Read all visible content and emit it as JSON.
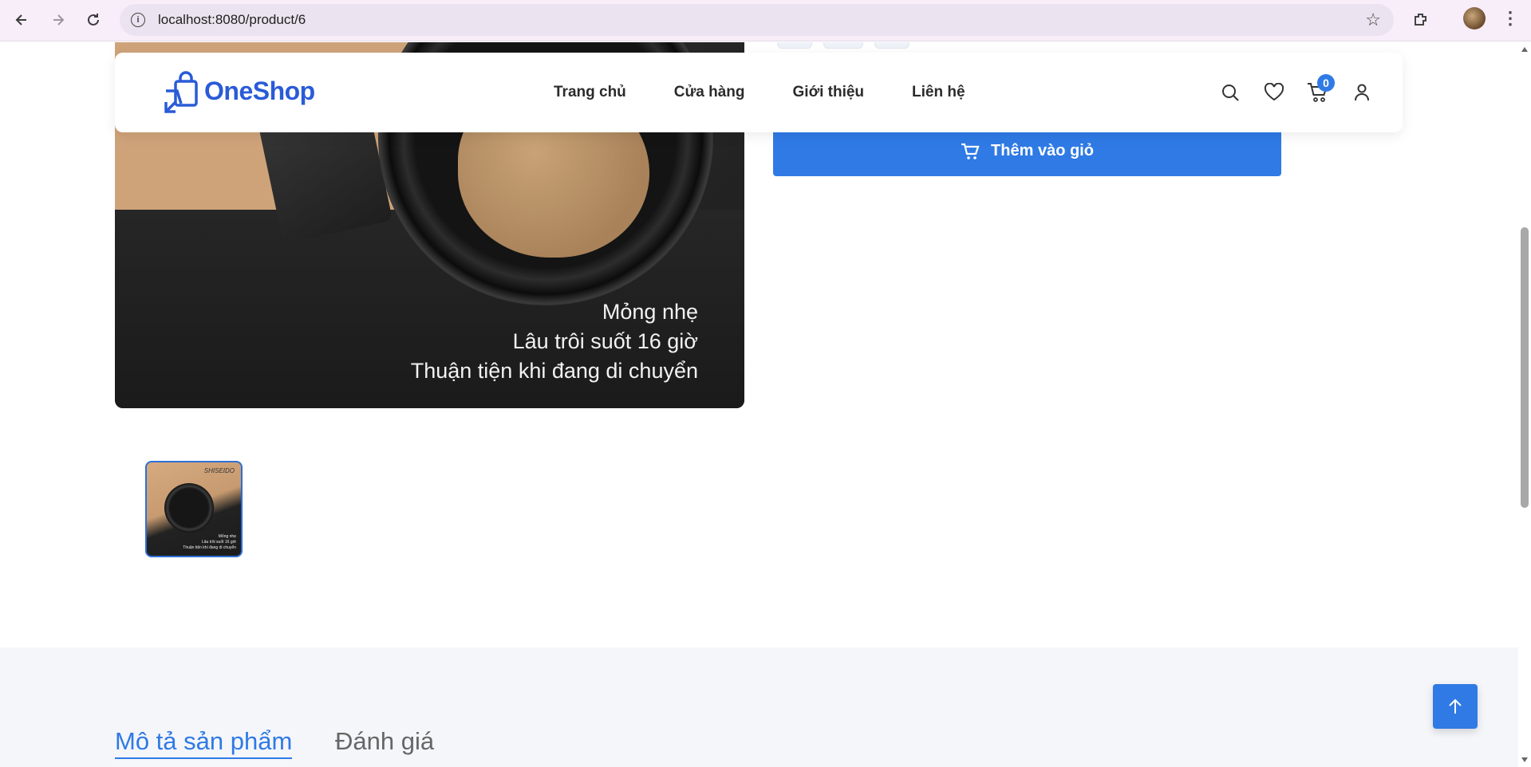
{
  "browser": {
    "url": "localhost:8080/product/6",
    "back_icon": "arrow-left-icon",
    "forward_icon": "arrow-right-icon",
    "reload_icon": "reload-icon"
  },
  "navbar": {
    "brand": "OneShop",
    "links": [
      "Trang chủ",
      "Cửa hàng",
      "Giới thiệu",
      "Liên hệ"
    ],
    "cart_count": "0"
  },
  "product": {
    "image_caption": [
      "Mỏng nhẹ",
      "Lâu trôi suốt 16 giờ",
      "Thuận tiện khi đang di chuyển"
    ],
    "add_to_cart_label": "Thêm vào giỏ"
  },
  "tabs": {
    "description": "Mô tả sản phẩm",
    "reviews": "Đánh giá"
  },
  "colors": {
    "accent": "#2f7ae5",
    "brand": "#2a5bd7"
  }
}
